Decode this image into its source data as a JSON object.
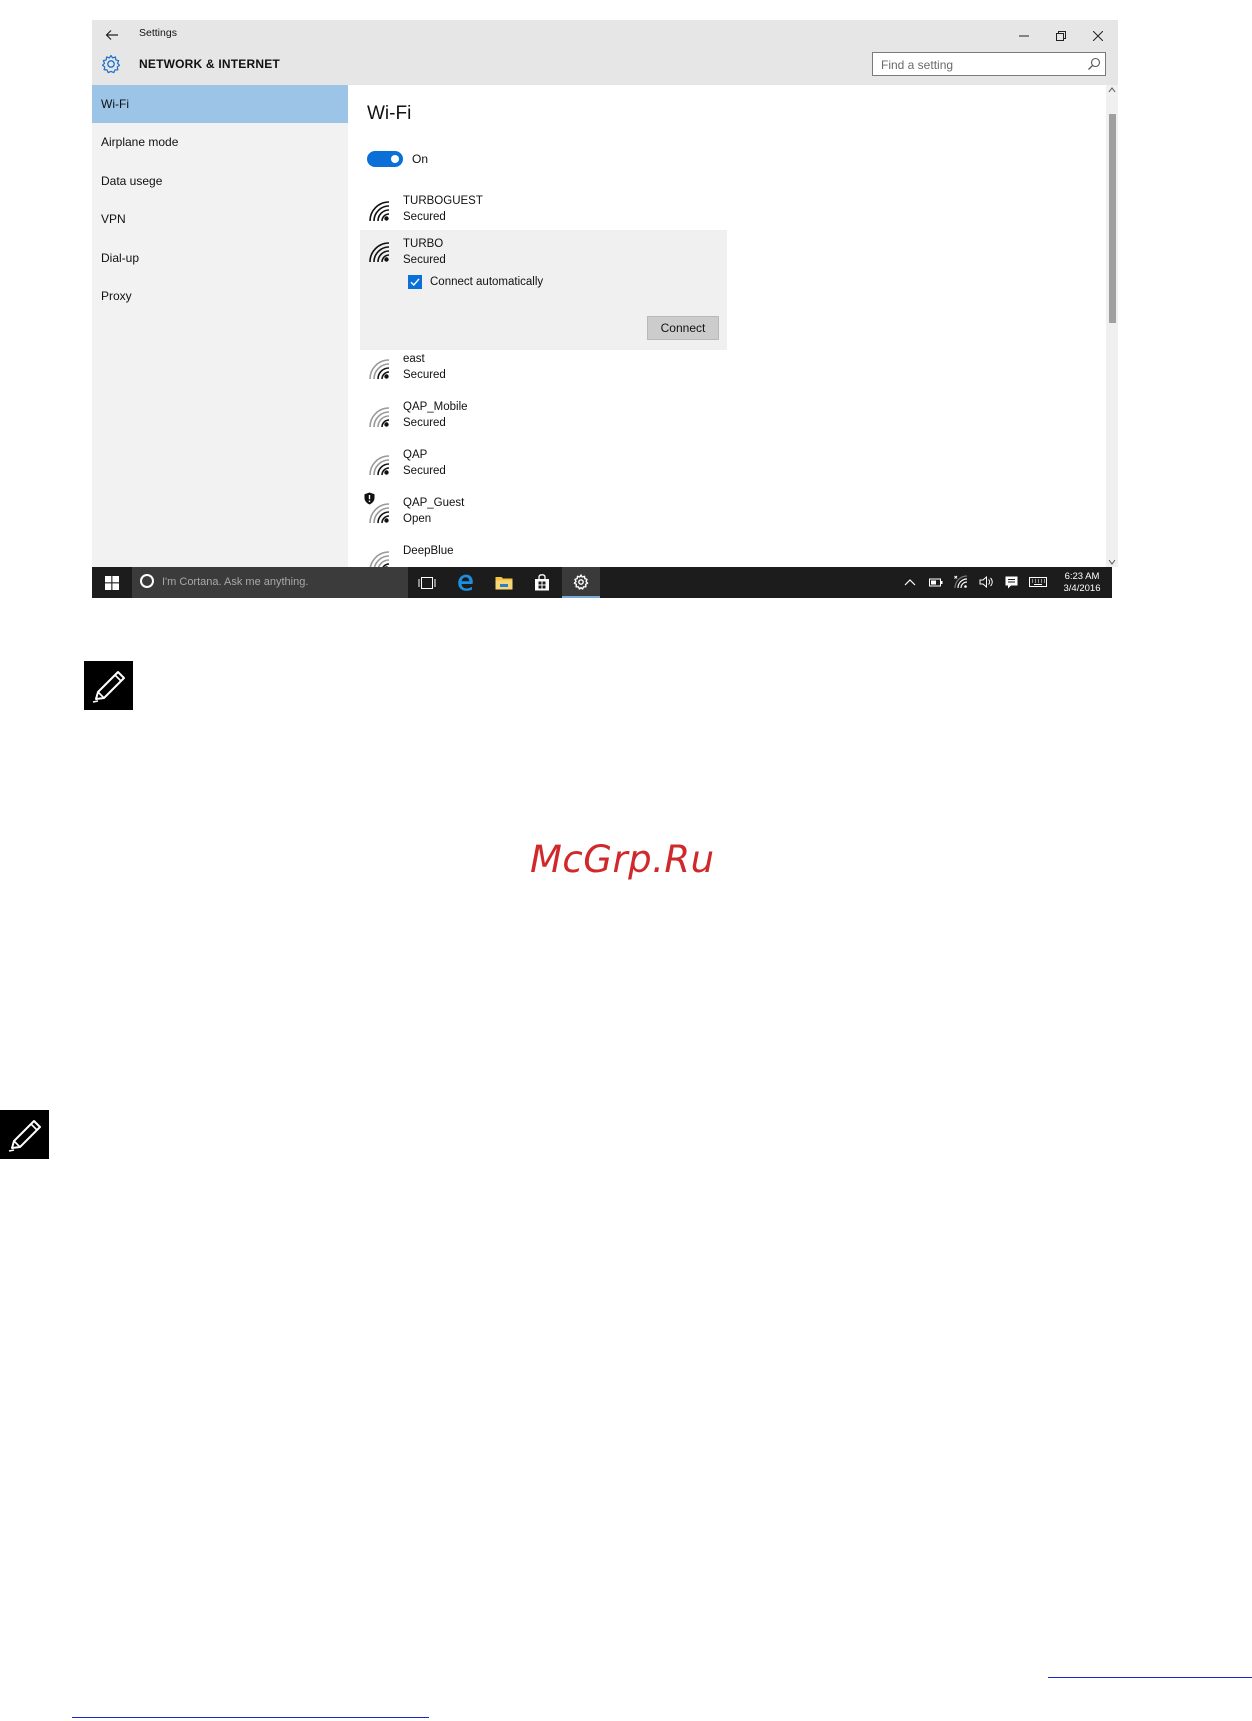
{
  "window": {
    "title": "Settings",
    "section_title": "NETWORK & INTERNET",
    "search_placeholder": "Find a setting"
  },
  "sidebar": {
    "items": [
      {
        "label": "Wi-Fi",
        "active": true
      },
      {
        "label": "Airplane mode",
        "active": false
      },
      {
        "label": "Data usege",
        "active": false
      },
      {
        "label": "VPN",
        "active": false
      },
      {
        "label": "Dial-up",
        "active": false
      },
      {
        "label": "Proxy",
        "active": false
      }
    ]
  },
  "wifi": {
    "heading": "Wi-Fi",
    "toggle_label": "On",
    "networks": [
      {
        "name": "TURBOGUEST",
        "status": "Secured"
      },
      {
        "name": "TURBO",
        "status": "Secured",
        "connect_auto_label": "Connect automatically",
        "connect_button": "Connect"
      },
      {
        "name": "east",
        "status": "Secured"
      },
      {
        "name": "QAP_Mobile",
        "status": "Secured"
      },
      {
        "name": "QAP",
        "status": "Secured"
      },
      {
        "name": "QAP_Guest",
        "status": "Open"
      },
      {
        "name": "DeepBlue",
        "status": ""
      }
    ]
  },
  "taskbar": {
    "cortana_placeholder": "I'm Cortana. Ask me anything.",
    "time": "6:23 AM",
    "date": "3/4/2016"
  },
  "document": {
    "watermark": "McGrp.Ru"
  },
  "colors": {
    "accent": "#0a6fd6",
    "sidebar_active": "#9bc4e6",
    "taskbar": "#1c1c1c",
    "watermark": "#d0282b"
  }
}
